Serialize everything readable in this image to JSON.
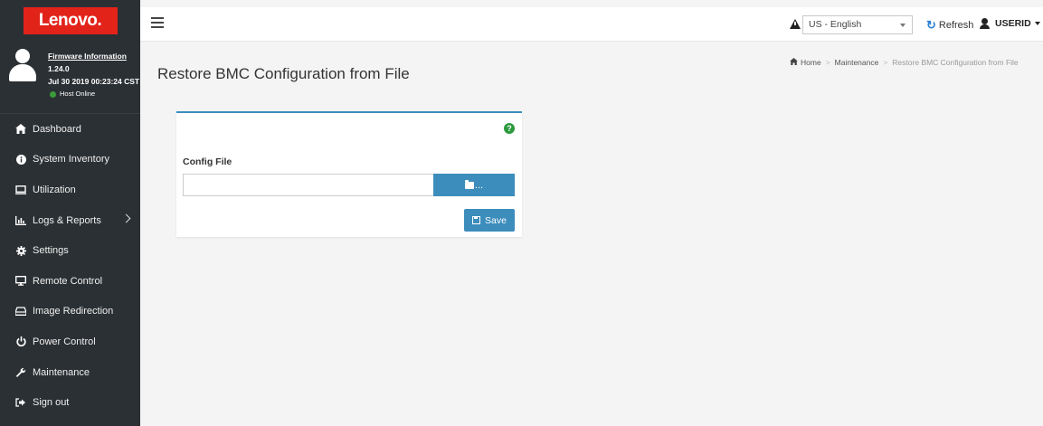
{
  "brand": {
    "logo_text": "Lenovo."
  },
  "user_panel": {
    "firmware_link": "Firmware Information",
    "version": "1.24.0",
    "build_date": "Jul 30 2019 00:23:24 CST",
    "host_status": "Host Online"
  },
  "sidebar": {
    "items": [
      {
        "label": "Dashboard",
        "icon": "home-icon"
      },
      {
        "label": "System Inventory",
        "icon": "info-icon"
      },
      {
        "label": "Utilization",
        "icon": "monitor-icon"
      },
      {
        "label": "Logs & Reports",
        "icon": "bar-chart-icon"
      },
      {
        "label": "Settings",
        "icon": "gear-icon"
      },
      {
        "label": "Remote Control",
        "icon": "desktop-icon"
      },
      {
        "label": "Image Redirection",
        "icon": "drive-icon"
      },
      {
        "label": "Power Control",
        "icon": "power-icon"
      },
      {
        "label": "Maintenance",
        "icon": "wrench-icon"
      },
      {
        "label": "Sign out",
        "icon": "sign-out-icon"
      }
    ]
  },
  "topbar": {
    "language": "US - English",
    "refresh_label": "Refresh",
    "user_label": "USERID"
  },
  "page": {
    "title": "Restore BMC Configuration from File",
    "breadcrumb": [
      "Home",
      "Maintenance",
      "Restore BMC Configuration from File"
    ]
  },
  "form": {
    "config_file_label": "Config File",
    "config_file_value": "",
    "browse_label": "...",
    "save_label": "Save"
  },
  "colors": {
    "sidebar_bg": "#2b3034",
    "brand_red": "#e2231a",
    "primary_button": "#3c8dbc",
    "help_green": "#2c9a3e",
    "status_online": "#3a9b3a"
  }
}
